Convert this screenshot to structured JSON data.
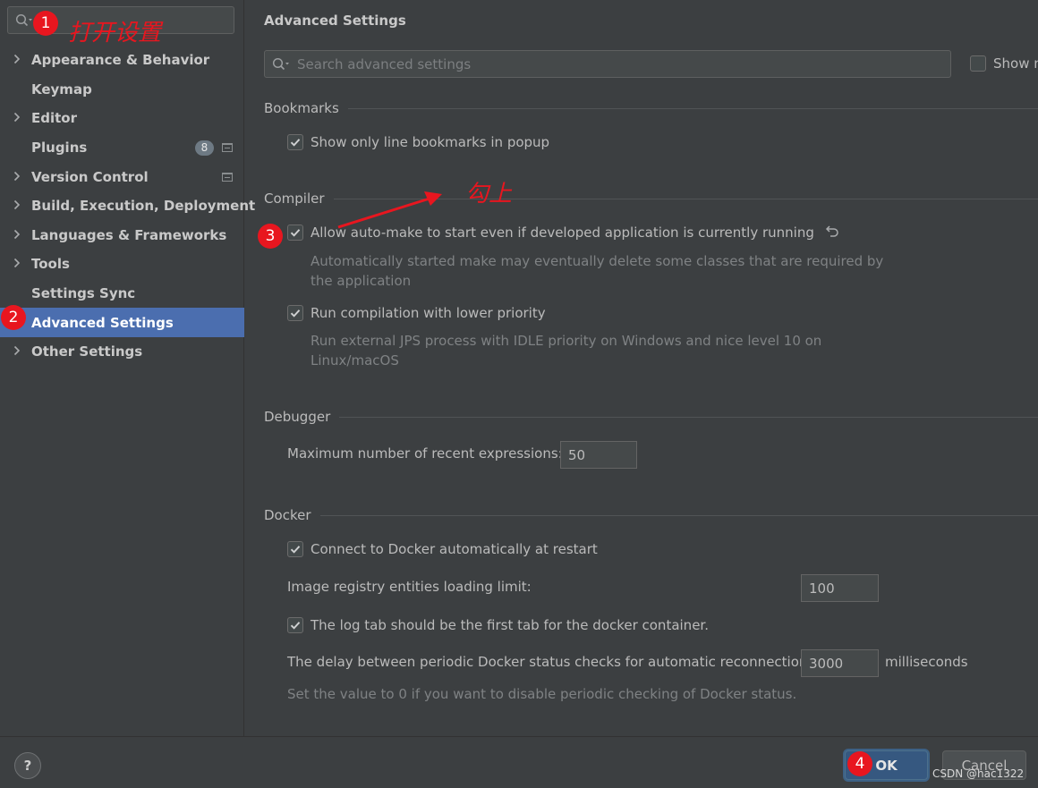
{
  "sidebar": {
    "search_placeholder": "",
    "items": [
      {
        "label": "Appearance & Behavior",
        "expandable": true
      },
      {
        "label": "Keymap",
        "expandable": false
      },
      {
        "label": "Editor",
        "expandable": true
      },
      {
        "label": "Plugins",
        "expandable": false,
        "badge": "8"
      },
      {
        "label": "Version Control",
        "expandable": true
      },
      {
        "label": "Build, Execution, Deployment",
        "expandable": true
      },
      {
        "label": "Languages & Frameworks",
        "expandable": true
      },
      {
        "label": "Tools",
        "expandable": true
      },
      {
        "label": "Settings Sync",
        "expandable": false
      },
      {
        "label": "Advanced Settings",
        "expandable": false,
        "selected": true
      },
      {
        "label": "Other Settings",
        "expandable": true
      }
    ]
  },
  "main": {
    "title": "Advanced Settings",
    "search_placeholder": "Search advanced settings",
    "show_modified_label": "Show n",
    "sections": {
      "bookmarks": {
        "header": "Bookmarks",
        "opt1_label": "Show only line bookmarks in popup"
      },
      "compiler": {
        "header": "Compiler",
        "opt1_label": "Allow auto-make to start even if developed application is currently running",
        "opt1_desc_line1": "Automatically started make may eventually delete some classes that are required by",
        "opt1_desc_line2": "the application",
        "opt2_label": "Run compilation with lower priority",
        "opt2_desc_line1": "Run external JPS process with IDLE priority on Windows and nice level 10 on",
        "opt2_desc_line2": "Linux/macOS"
      },
      "debugger": {
        "header": "Debugger",
        "max_recent_label": "Maximum number of recent expressions:",
        "max_recent_value": "50"
      },
      "docker": {
        "header": "Docker",
        "connect_label": "Connect to Docker automatically at restart",
        "registry_label": "Image registry entities loading limit:",
        "registry_value": "100",
        "log_tab_label": "The log tab should be the first tab for the docker container.",
        "delay_label": "The delay between periodic Docker status checks for automatic reconnection:",
        "delay_value": "3000",
        "delay_unit": "milliseconds",
        "note": "Set the value to 0 if you want to disable periodic checking of Docker status."
      }
    }
  },
  "footer": {
    "help_label": "?",
    "ok_label": "OK",
    "cancel_label": "Cancel",
    "watermark": "CSDN @hac1322"
  },
  "annotations": {
    "m1": "1",
    "m2": "2",
    "m3": "3",
    "m4": "4",
    "open_settings_text": "打开设置",
    "check_it_text": "勾上"
  },
  "colors": {
    "accent_selected": "#4b6eaf",
    "annotation_red": "#e8161f",
    "ok_button": "#365880"
  }
}
